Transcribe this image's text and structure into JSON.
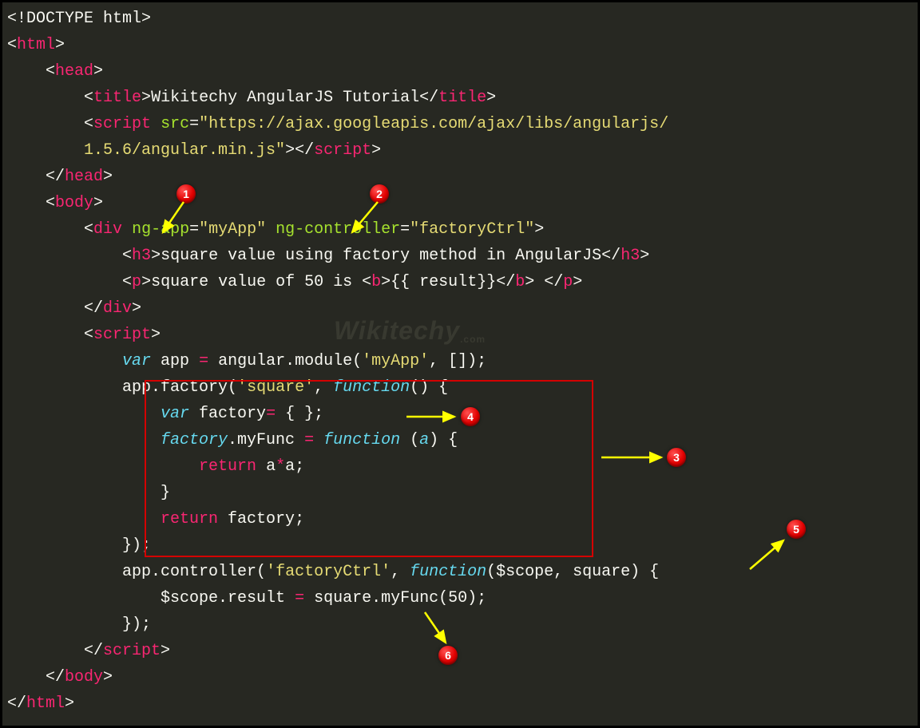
{
  "code": {
    "doctype": "<!DOCTYPE html>",
    "html_open": "html",
    "head_open": "head",
    "title_tag": "title",
    "title_text": "Wikitechy AngularJS Tutorial",
    "script_tag": "script",
    "src_attr": "src",
    "src_val": "\"https://ajax.googleapis.com/ajax/libs/angularjs/",
    "src_val2": "        1.5.6/angular.min.js\"",
    "body_open": "body",
    "div_tag": "div",
    "ngapp_attr": "ng-app",
    "ngapp_val": "\"myApp\"",
    "ngctrl_attr": "ng-controller",
    "ngctrl_val": "\"factoryCtrl\"",
    "h3_tag": "h3",
    "h3_text": "square value using factory method in AngularJS",
    "p_tag": "p",
    "p_text1": "square value of 50 is ",
    "b_tag": "b",
    "expr": "{{ result}}",
    "var_kw": "var",
    "app_var": " app ",
    "eq": "=",
    "module_call": " angular.module(",
    "myapp_str": "'myApp'",
    "empty_arr": ", []);",
    "factory_call": "app.factory(",
    "square_str": "'square'",
    "function_kw": "function",
    "fn_paren": "() {",
    "factory_decl": " factory",
    "empty_obj": " { };",
    "factory_ref": "factory",
    "myfunc": ".myFunc ",
    "fn_a": " (",
    "a_param": "a",
    "close_paren_brace": ") {",
    "return_kw": "return",
    "aa": " a",
    "star": "*",
    "aa2": "a;",
    "close_brace": "}",
    "ret_factory": " factory;",
    "close_fn": "});",
    "ctrl_call": "app.controller(",
    "ctrl_str": "'factoryCtrl'",
    "ctrl_fn": "($scope, square) {",
    "scope_line": "$scope.result ",
    "square_call": " square.myFunc(",
    "fifty": "50",
    "close_call": ");"
  },
  "annotations": {
    "b1": "1",
    "b2": "2",
    "b3": "3",
    "b4": "4",
    "b5": "5",
    "b6": "6"
  },
  "watermark": "Wikitechy"
}
